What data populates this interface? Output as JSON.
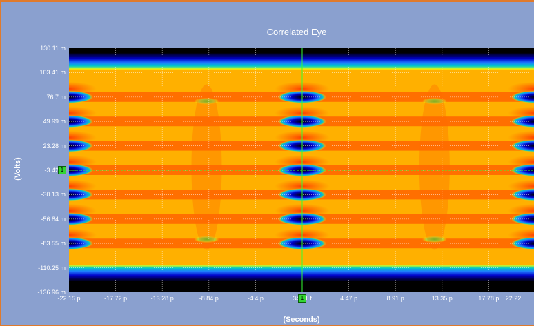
{
  "chart_data": {
    "type": "heatmap",
    "title": "Correlated Eye",
    "xlabel": "(Seconds)",
    "ylabel": "(Volts)",
    "x_ticks": [
      "-22.15 p",
      "-17.72 p",
      "-13.28 p",
      "-8.84 p",
      "-4.4 p",
      "34.41 f",
      "4.47 p",
      "8.91 p",
      "13.35 p",
      "17.78 p",
      "22.22"
    ],
    "y_ticks": [
      "130.11 m",
      "103.41 m",
      "76.7 m",
      "49.99 m",
      "23.28 m",
      "-3.42 m",
      "-30.13 m",
      "-56.84 m",
      "-83.55 m",
      "-110.25 m",
      "-136.96 m"
    ],
    "xlim": [
      -22.15,
      22.22
    ],
    "ylim": [
      -136.96,
      130.11
    ],
    "grid": true,
    "levels": [
      110,
      76.7,
      49.99,
      23.28,
      -3.42,
      -30.13,
      -56.84,
      -83.55,
      -110
    ],
    "cursor": {
      "x": 34.41,
      "y": -3.42,
      "x_marker_label": "1",
      "y_marker_label": "1"
    },
    "colormap": [
      "#000000",
      "#0000c8",
      "#1e78ff",
      "#00c8c8",
      "#32d232",
      "#ffff00",
      "#ffa000",
      "#ff2800"
    ]
  }
}
